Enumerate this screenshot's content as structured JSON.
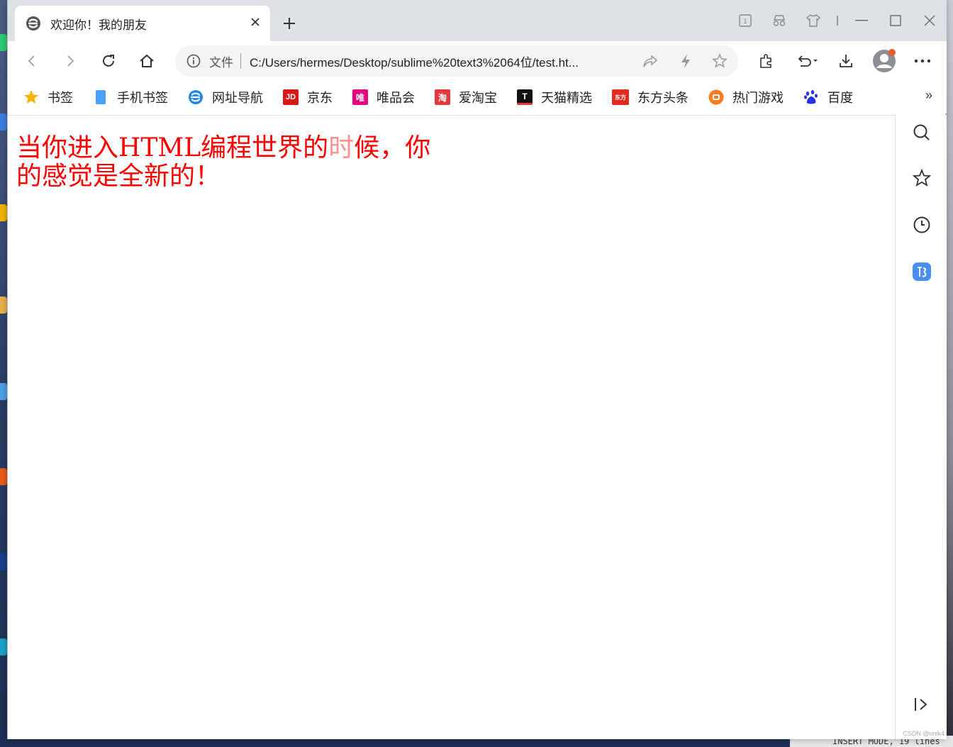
{
  "browser": {
    "tab": {
      "title": "欢迎你！我的朋友"
    },
    "address_bar": {
      "scheme_label": "文件",
      "url": "C:/Users/hermes/Desktop/sublime%20text3%2064位/test.ht..."
    },
    "bookmarks": [
      {
        "label": "书签",
        "icon": "star-icon",
        "color": "#f5b400"
      },
      {
        "label": "手机书签",
        "icon": "phone-icon",
        "color": "#4aa3ff"
      },
      {
        "label": "网址导航",
        "icon": "browser-e-icon",
        "color": "#1e88e5"
      },
      {
        "label": "京东",
        "icon": "jd-icon",
        "icon_text": "JD",
        "color": "#d71a18"
      },
      {
        "label": "唯品会",
        "icon": "vip-icon",
        "icon_text": "唯",
        "color": "#e5007f"
      },
      {
        "label": "爱淘宝",
        "icon": "taobao-icon",
        "icon_text": "淘",
        "color": "#e4393c"
      },
      {
        "label": "天猫精选",
        "icon": "tmall-icon",
        "icon_text": "T",
        "color": "#111111"
      },
      {
        "label": "东方头条",
        "icon": "dftt-icon",
        "icon_text": "东方",
        "color": "#e22b1f"
      },
      {
        "label": "热门游戏",
        "icon": "game-icon",
        "color": "#ff7a1a"
      },
      {
        "label": "百度",
        "icon": "baidu-paw-icon",
        "color": "#2932e1"
      }
    ],
    "bookmarks_more": "»"
  },
  "page": {
    "text_main": "当你进入HTML编程世界的",
    "text_faded": "时",
    "text_rest": "候，你的感觉是全新的！",
    "text_color": "#ff0000"
  },
  "desktop": {
    "editor_status": "INSERT MODE, 19 lines",
    "watermark": "CSDN @unik4"
  }
}
